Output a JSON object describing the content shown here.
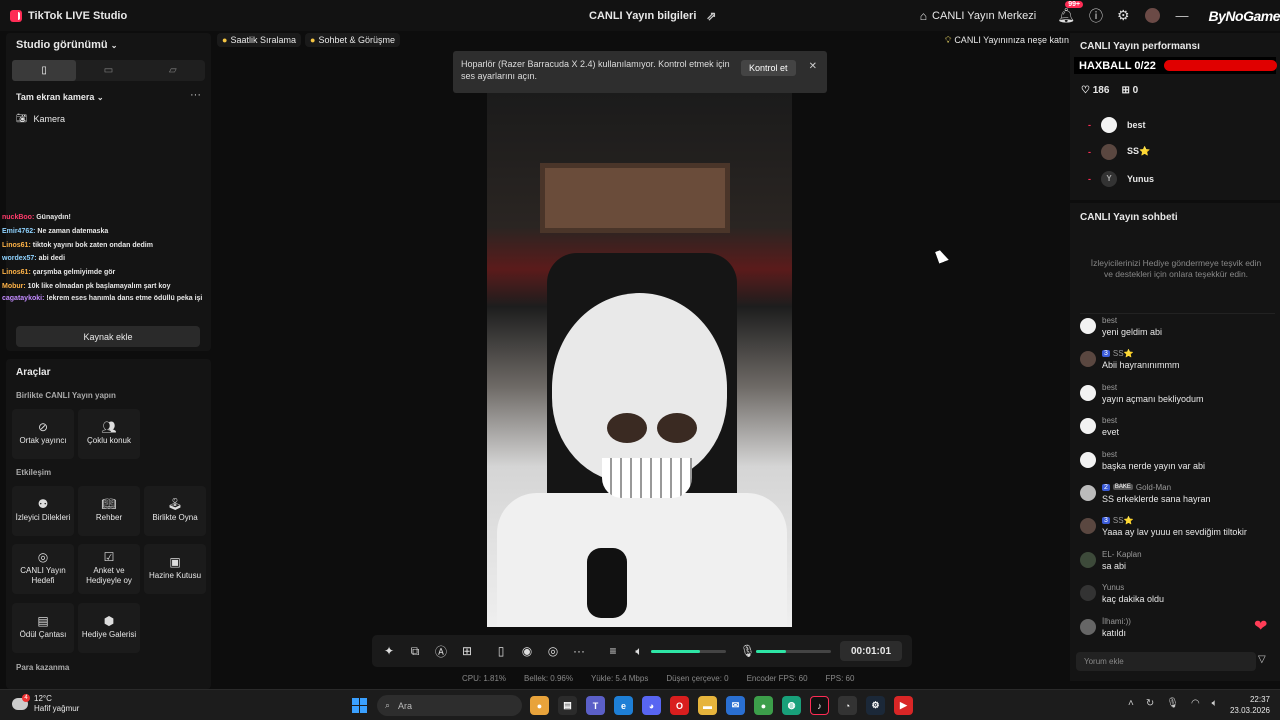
{
  "app": {
    "title": "TikTok LIVE Studio",
    "center_title": "CANLI Yayın bilgileri",
    "hub_label": "CANLI Yayın Merkezi",
    "notif_count": "99+",
    "logo_text": "ByNoGame"
  },
  "left": {
    "studio_view": "Studio görünümü",
    "scene_label": "Tam ekran kamera",
    "source_label": "Kamera",
    "add_source": "Kaynak ekle",
    "chat_overlay": [
      {
        "user": "nuckBoo:",
        "text": "Günaydın!",
        "color": "#ff3b6b"
      },
      {
        "user": "Emir4762:",
        "text": "Ne zaman datemaska",
        "color": "#8fd3ff"
      },
      {
        "user": "Linos61:",
        "text": "tiktok yayını bok zaten ondan dedim",
        "color": "#ffb347"
      },
      {
        "user": "wordex57:",
        "text": "abi dedi",
        "color": "#8fd3ff"
      },
      {
        "user": "Linos61:",
        "text": "çarşmba gelmiyimde gör",
        "color": "#ffb347"
      },
      {
        "user": "Mobur:",
        "text": "10k like olmadan pk başlamayalım şart koy",
        "color": "#ffb347"
      },
      {
        "user": "cagataykoki:",
        "text": "!ekrem eses hanımla dans etme ödüllü peka işi",
        "color": "#c38bff"
      }
    ]
  },
  "tools": {
    "title": "Araçlar",
    "section1": "Birlikte CANLI Yayın yapın",
    "section2": "Etkileşim",
    "section3": "Para kazanma",
    "items1": [
      "Ortak yayıncı",
      "Çoklu konuk"
    ],
    "items2": [
      "İzleyici Dilekleri",
      "Rehber",
      "Birlikte Oyna",
      "CANLI Yayın Hedefi",
      "Anket ve Hediyeyle oy",
      "Hazine Kutusu",
      "Ödül Çantası",
      "Hediye Galerisi"
    ]
  },
  "quick": {
    "hourly": "Saatlik Sıralama",
    "chat": "Sohbet & Görüşme",
    "fun": "CANLI Yayınınıza neşe katın"
  },
  "notice": {
    "text": "Hoparlör (Razer Barracuda X 2.4) kullanılamıyor. Kontrol etmek için ses ayarlarını açın.",
    "button": "Kontrol et"
  },
  "controls": {
    "timer": "00:01:01",
    "speaker_volume": 0.65,
    "mic_volume": 0.4
  },
  "stats": {
    "cpu": "CPU: 1.81%",
    "memory": "Bellek: 0.96%",
    "upload": "Yükle: 5.4 Mbps",
    "dropped": "Düşen çerçeve: 0",
    "encoder_fps": "Encoder FPS: 60",
    "fps": "FPS: 60"
  },
  "performance": {
    "title": "CANLI Yayın performansı",
    "haxball": "HAXBALL 0/22",
    "likes": "186",
    "gifts": "0",
    "ranking": [
      {
        "name": "best",
        "av": ""
      },
      {
        "name": "SS⭐",
        "av": ""
      },
      {
        "name": "Yunus",
        "av": "Y"
      }
    ]
  },
  "chat": {
    "title": "CANLI Yayın sohbeti",
    "empty_text": "İzleyicilerinizi Hediye göndermeye teşvik edin ve destekleri için onlara teşekkür edin.",
    "input_placeholder": "Yorum ekle",
    "messages": [
      {
        "user": "best",
        "text": "yeni geldim abi",
        "level": "",
        "badge": ""
      },
      {
        "user": "SS⭐",
        "text": "Abii hayranınımmm",
        "level": "3",
        "badge": ""
      },
      {
        "user": "best",
        "text": "yayın açmanı bekliyodum",
        "level": "",
        "badge": ""
      },
      {
        "user": "best",
        "text": "evet",
        "level": "",
        "badge": ""
      },
      {
        "user": "best",
        "text": "başka nerde yayın var abi",
        "level": "",
        "badge": ""
      },
      {
        "user": "Gold-Man",
        "text": "SS erkeklerde sana hayran",
        "level": "2",
        "badge": "BAKE"
      },
      {
        "user": "SS⭐",
        "text": "Yaaa ay lav yuuu en sevdiğim tiltokir",
        "level": "3",
        "badge": ""
      },
      {
        "user": "EL- Kaplan",
        "text": "sa abi",
        "level": "",
        "badge": ""
      },
      {
        "user": "Yunus",
        "text": "kaç dakika oldu",
        "level": "",
        "badge": ""
      },
      {
        "user": "İlhami:))",
        "text": "katıldı",
        "level": "",
        "badge": ""
      }
    ]
  },
  "taskbar": {
    "temp": "12°C",
    "weather": "Hafif yağmur",
    "weather_badge": "4",
    "search": "Ara",
    "time": "22:37",
    "date": "23.03.2026"
  }
}
